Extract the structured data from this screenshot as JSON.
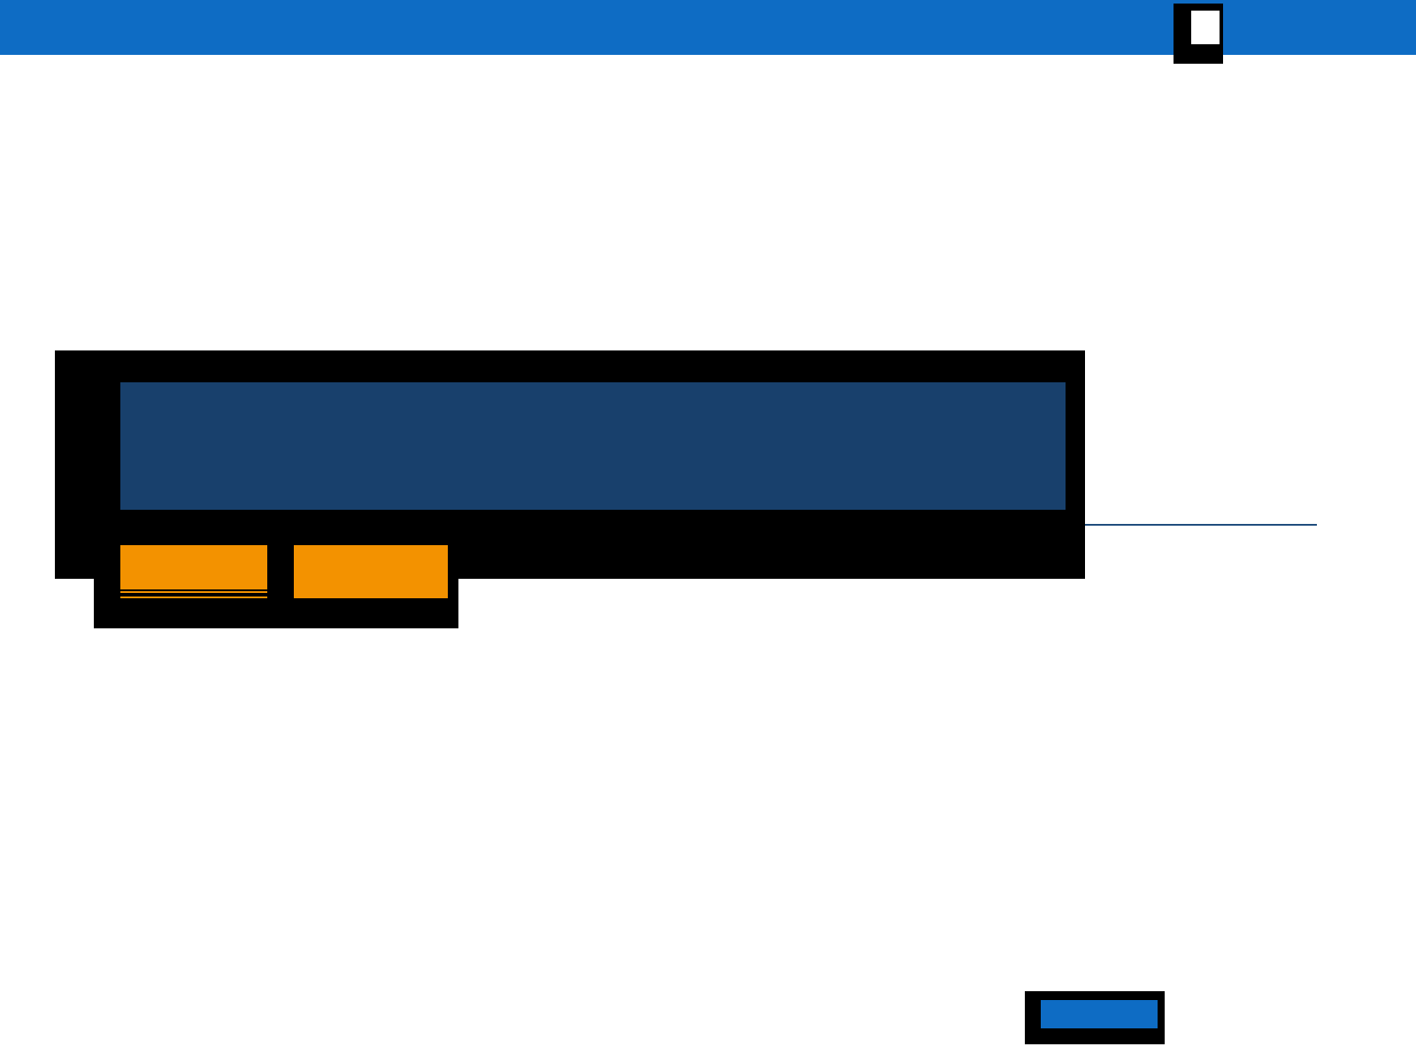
{
  "tabs": [
    {
      "selected": true
    },
    {
      "selected": false
    }
  ]
}
